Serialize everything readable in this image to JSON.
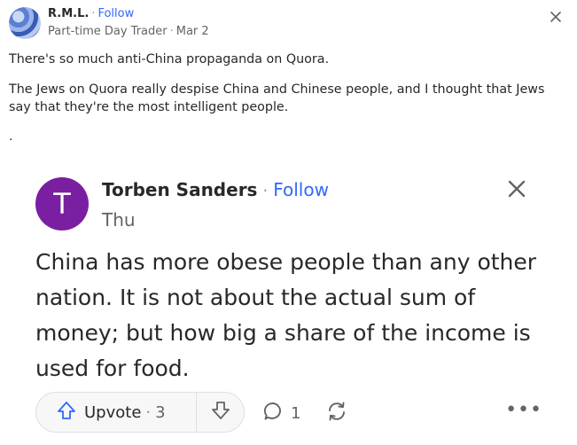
{
  "post": {
    "author": "R.M.L.",
    "separator": "·",
    "follow_label": "Follow",
    "credential": "Part-time Day Trader",
    "date": "Mar 2",
    "paragraphs": [
      "There's so much anti-China propaganda on Quora.",
      "The Jews on Quora really despise China and Chinese people, and I thought that Jews say that they're the most intelligent people."
    ],
    "trailing_text": "."
  },
  "embedded": {
    "avatar_letter": "T",
    "author": "Torben Sanders",
    "separator": "·",
    "follow_label": "Follow",
    "date": "Thu",
    "text": "China has more obese people than any other nation. It is not about the actual sum of money; but how big a share of the income is used for food.",
    "actions": {
      "upvote_label": "Upvote",
      "upvote_separator": "·",
      "upvote_count": "3",
      "comment_count": "1",
      "more_label": "•••"
    }
  }
}
